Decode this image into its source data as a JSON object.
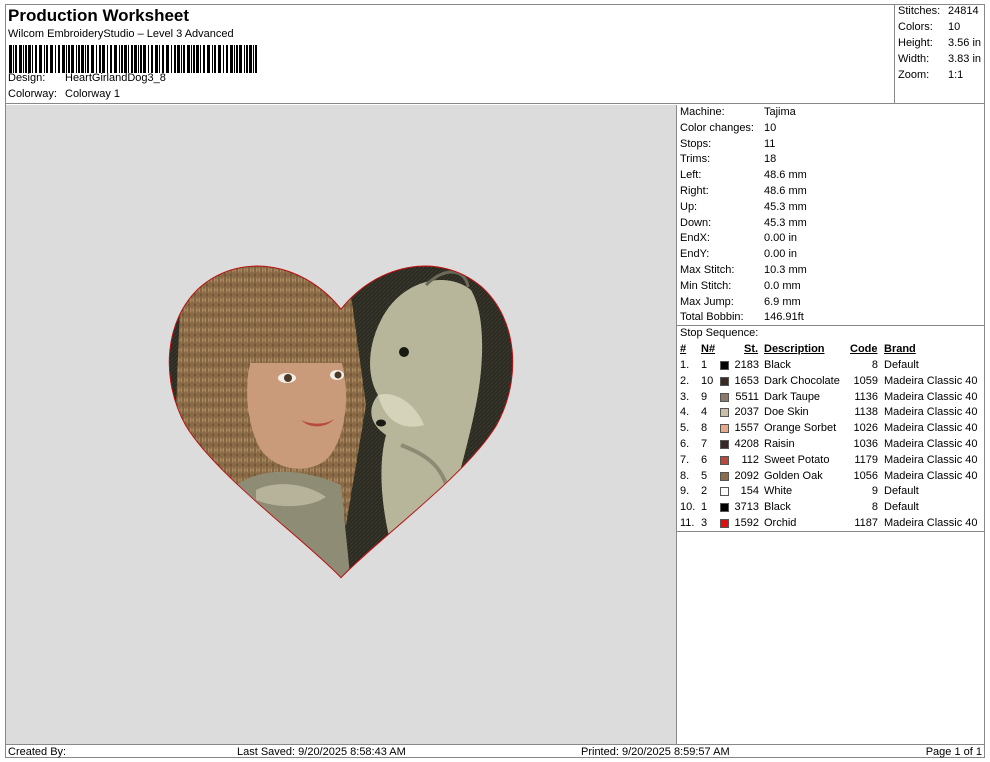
{
  "header": {
    "title": "Production Worksheet",
    "software": "Wilcom EmbroideryStudio – Level 3 Advanced",
    "design_label": "Design:",
    "design_value": "HeartGirlandDog3_8",
    "colorway_label": "Colorway:",
    "colorway_value": "Colorway 1"
  },
  "stats": {
    "stitches_label": "Stitches:",
    "stitches_value": "24814",
    "colors_label": "Colors:",
    "colors_value": "10",
    "height_label": "Height:",
    "height_value": "3.56 in",
    "width_label": "Width:",
    "width_value": "3.83 in",
    "zoom_label": "Zoom:",
    "zoom_value": "1:1"
  },
  "machine": [
    {
      "k": "Machine:",
      "v": "Tajima"
    },
    {
      "k": "Color changes:",
      "v": "10"
    },
    {
      "k": "Stops:",
      "v": "11"
    },
    {
      "k": "Trims:",
      "v": "18"
    },
    {
      "k": "Left:",
      "v": "48.6 mm"
    },
    {
      "k": "Right:",
      "v": "48.6 mm"
    },
    {
      "k": "Up:",
      "v": "45.3 mm"
    },
    {
      "k": "Down:",
      "v": "45.3 mm"
    },
    {
      "k": "EndX:",
      "v": "0.00 in"
    },
    {
      "k": "EndY:",
      "v": "0.00 in"
    },
    {
      "k": "Max Stitch:",
      "v": "10.3 mm"
    },
    {
      "k": "Min Stitch:",
      "v": "0.0 mm"
    },
    {
      "k": "Max Jump:",
      "v": "6.9 mm"
    },
    {
      "k": "Total Bobbin:",
      "v": "146.91ft"
    }
  ],
  "stop_sequence": {
    "label": "Stop Sequence:",
    "headers": {
      "num": "#",
      "n": "N#",
      "st": "St.",
      "desc": "Description",
      "code": "Code",
      "brand": "Brand"
    },
    "rows": [
      {
        "num": "1.",
        "n": "1",
        "color": "#000000",
        "st": "2183",
        "desc": "Black",
        "code": "8",
        "brand": "Default"
      },
      {
        "num": "2.",
        "n": "10",
        "color": "#3b2a22",
        "st": "1653",
        "desc": "Dark Chocolate",
        "code": "1059",
        "brand": "Madeira Classic 40"
      },
      {
        "num": "3.",
        "n": "9",
        "color": "#8a7a6a",
        "st": "5511",
        "desc": "Dark Taupe",
        "code": "1136",
        "brand": "Madeira Classic 40"
      },
      {
        "num": "4.",
        "n": "4",
        "color": "#c9bfa6",
        "st": "2037",
        "desc": "Doe Skin",
        "code": "1138",
        "brand": "Madeira Classic 40"
      },
      {
        "num": "5.",
        "n": "8",
        "color": "#e6a98a",
        "st": "1557",
        "desc": "Orange Sorbet",
        "code": "1026",
        "brand": "Madeira Classic 40"
      },
      {
        "num": "6.",
        "n": "7",
        "color": "#3a2624",
        "st": "4208",
        "desc": "Raisin",
        "code": "1036",
        "brand": "Madeira Classic 40"
      },
      {
        "num": "7.",
        "n": "6",
        "color": "#b8493e",
        "st": "112",
        "desc": "Sweet Potato",
        "code": "1179",
        "brand": "Madeira Classic 40"
      },
      {
        "num": "8.",
        "n": "5",
        "color": "#8c6c4e",
        "st": "2092",
        "desc": "Golden Oak",
        "code": "1056",
        "brand": "Madeira Classic 40"
      },
      {
        "num": "9.",
        "n": "2",
        "color": "#ffffff",
        "st": "154",
        "desc": "White",
        "code": "9",
        "brand": "Default"
      },
      {
        "num": "10.",
        "n": "1",
        "color": "#000000",
        "st": "3713",
        "desc": "Black",
        "code": "8",
        "brand": "Default"
      },
      {
        "num": "11.",
        "n": "3",
        "color": "#e01010",
        "st": "1592",
        "desc": "Orchid",
        "code": "1187",
        "brand": "Madeira Classic 40"
      }
    ]
  },
  "footer": {
    "created": "Created By:",
    "saved": "Last Saved: 9/20/2025 8:58:43 AM",
    "printed": "Printed: 9/20/2025 8:59:57 AM",
    "page": "Page 1 of 1"
  }
}
